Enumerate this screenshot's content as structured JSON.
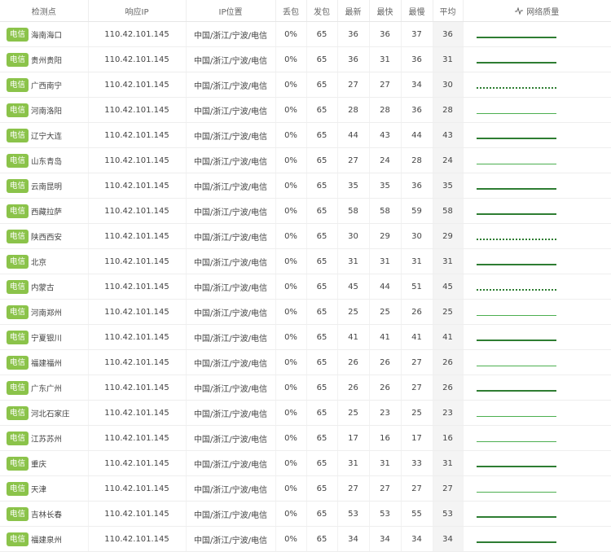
{
  "headers": {
    "node": "检测点",
    "ip": "响应IP",
    "location": "IP位置",
    "loss": "丢包",
    "sent": "发包",
    "latest": "最新",
    "fastest": "最快",
    "slowest": "最慢",
    "avg": "平均",
    "quality": "网络质量"
  },
  "rows": [
    {
      "isp": "电信",
      "city": "海南海口",
      "ip": "110.42.101.145",
      "loc": "中国/浙江/宁波/电信",
      "loss": "0%",
      "sent": "65",
      "latest": "36",
      "fastest": "36",
      "slowest": "37",
      "avg": "36"
    },
    {
      "isp": "电信",
      "city": "贵州贵阳",
      "ip": "110.42.101.145",
      "loc": "中国/浙江/宁波/电信",
      "loss": "0%",
      "sent": "65",
      "latest": "36",
      "fastest": "31",
      "slowest": "36",
      "avg": "31"
    },
    {
      "isp": "电信",
      "city": "广西南宁",
      "ip": "110.42.101.145",
      "loc": "中国/浙江/宁波/电信",
      "loss": "0%",
      "sent": "65",
      "latest": "27",
      "fastest": "27",
      "slowest": "34",
      "avg": "30"
    },
    {
      "isp": "电信",
      "city": "河南洛阳",
      "ip": "110.42.101.145",
      "loc": "中国/浙江/宁波/电信",
      "loss": "0%",
      "sent": "65",
      "latest": "28",
      "fastest": "28",
      "slowest": "36",
      "avg": "28"
    },
    {
      "isp": "电信",
      "city": "辽宁大连",
      "ip": "110.42.101.145",
      "loc": "中国/浙江/宁波/电信",
      "loss": "0%",
      "sent": "65",
      "latest": "44",
      "fastest": "43",
      "slowest": "44",
      "avg": "43"
    },
    {
      "isp": "电信",
      "city": "山东青岛",
      "ip": "110.42.101.145",
      "loc": "中国/浙江/宁波/电信",
      "loss": "0%",
      "sent": "65",
      "latest": "27",
      "fastest": "24",
      "slowest": "28",
      "avg": "24"
    },
    {
      "isp": "电信",
      "city": "云南昆明",
      "ip": "110.42.101.145",
      "loc": "中国/浙江/宁波/电信",
      "loss": "0%",
      "sent": "65",
      "latest": "35",
      "fastest": "35",
      "slowest": "36",
      "avg": "35"
    },
    {
      "isp": "电信",
      "city": "西藏拉萨",
      "ip": "110.42.101.145",
      "loc": "中国/浙江/宁波/电信",
      "loss": "0%",
      "sent": "65",
      "latest": "58",
      "fastest": "58",
      "slowest": "59",
      "avg": "58"
    },
    {
      "isp": "电信",
      "city": "陕西西安",
      "ip": "110.42.101.145",
      "loc": "中国/浙江/宁波/电信",
      "loss": "0%",
      "sent": "65",
      "latest": "30",
      "fastest": "29",
      "slowest": "30",
      "avg": "29"
    },
    {
      "isp": "电信",
      "city": "北京",
      "ip": "110.42.101.145",
      "loc": "中国/浙江/宁波/电信",
      "loss": "0%",
      "sent": "65",
      "latest": "31",
      "fastest": "31",
      "slowest": "31",
      "avg": "31"
    },
    {
      "isp": "电信",
      "city": "内蒙古",
      "ip": "110.42.101.145",
      "loc": "中国/浙江/宁波/电信",
      "loss": "0%",
      "sent": "65",
      "latest": "45",
      "fastest": "44",
      "slowest": "51",
      "avg": "45"
    },
    {
      "isp": "电信",
      "city": "河南郑州",
      "ip": "110.42.101.145",
      "loc": "中国/浙江/宁波/电信",
      "loss": "0%",
      "sent": "65",
      "latest": "25",
      "fastest": "25",
      "slowest": "26",
      "avg": "25"
    },
    {
      "isp": "电信",
      "city": "宁夏银川",
      "ip": "110.42.101.145",
      "loc": "中国/浙江/宁波/电信",
      "loss": "0%",
      "sent": "65",
      "latest": "41",
      "fastest": "41",
      "slowest": "41",
      "avg": "41"
    },
    {
      "isp": "电信",
      "city": "福建福州",
      "ip": "110.42.101.145",
      "loc": "中国/浙江/宁波/电信",
      "loss": "0%",
      "sent": "65",
      "latest": "26",
      "fastest": "26",
      "slowest": "27",
      "avg": "26"
    },
    {
      "isp": "电信",
      "city": "广东广州",
      "ip": "110.42.101.145",
      "loc": "中国/浙江/宁波/电信",
      "loss": "0%",
      "sent": "65",
      "latest": "26",
      "fastest": "26",
      "slowest": "27",
      "avg": "26"
    },
    {
      "isp": "电信",
      "city": "河北石家庄",
      "ip": "110.42.101.145",
      "loc": "中国/浙江/宁波/电信",
      "loss": "0%",
      "sent": "65",
      "latest": "25",
      "fastest": "23",
      "slowest": "25",
      "avg": "23"
    },
    {
      "isp": "电信",
      "city": "江苏苏州",
      "ip": "110.42.101.145",
      "loc": "中国/浙江/宁波/电信",
      "loss": "0%",
      "sent": "65",
      "latest": "17",
      "fastest": "16",
      "slowest": "17",
      "avg": "16"
    },
    {
      "isp": "电信",
      "city": "重庆",
      "ip": "110.42.101.145",
      "loc": "中国/浙江/宁波/电信",
      "loss": "0%",
      "sent": "65",
      "latest": "31",
      "fastest": "31",
      "slowest": "33",
      "avg": "31"
    },
    {
      "isp": "电信",
      "city": "天津",
      "ip": "110.42.101.145",
      "loc": "中国/浙江/宁波/电信",
      "loss": "0%",
      "sent": "65",
      "latest": "27",
      "fastest": "27",
      "slowest": "27",
      "avg": "27"
    },
    {
      "isp": "电信",
      "city": "吉林长春",
      "ip": "110.42.101.145",
      "loc": "中国/浙江/宁波/电信",
      "loss": "0%",
      "sent": "65",
      "latest": "53",
      "fastest": "53",
      "slowest": "55",
      "avg": "53"
    },
    {
      "isp": "电信",
      "city": "福建泉州",
      "ip": "110.42.101.145",
      "loc": "中国/浙江/宁波/电信",
      "loss": "0%",
      "sent": "65",
      "latest": "34",
      "fastest": "34",
      "slowest": "34",
      "avg": "34"
    }
  ],
  "colors": {
    "isp_badge": "#8bc34a",
    "quality_line": "#2e7d32"
  },
  "icons": {
    "quality_header": "pulse-icon"
  }
}
